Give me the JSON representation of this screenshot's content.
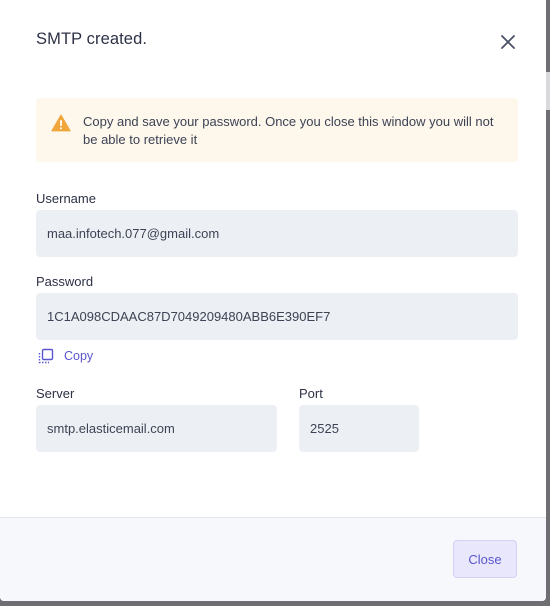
{
  "dialog": {
    "title": "SMTP created.",
    "close_icon": "close-icon"
  },
  "alert": {
    "icon": "warning-icon",
    "icon_color": "#f0a63a",
    "message": "Copy and save your password. Once you close this window you will not be able to retrieve it"
  },
  "username": {
    "label": "Username",
    "value": "maa.infotech.077@gmail.com"
  },
  "password": {
    "label": "Password",
    "value": "1C1A098CDAAC87D7049209480ABB6E390EF7",
    "copy_label": "Copy",
    "copy_icon": "copy-icon"
  },
  "server": {
    "label": "Server",
    "value": "smtp.elasticemail.com"
  },
  "port": {
    "label": "Port",
    "value": "2525"
  },
  "footer": {
    "close_label": "Close"
  },
  "colors": {
    "accent": "#5a56d1",
    "field_bg": "#ecf0f4",
    "alert_bg": "#fdf7ec"
  }
}
